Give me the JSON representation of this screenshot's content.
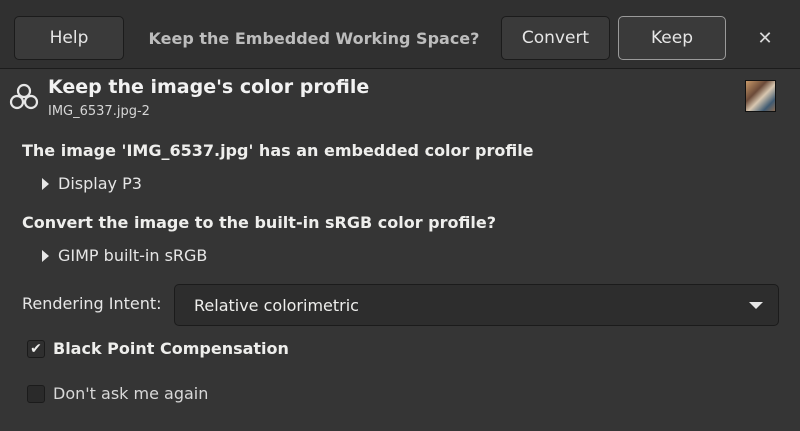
{
  "headerbar": {
    "help_label": "Help",
    "title": "Keep the Embedded Working Space?",
    "convert_label": "Convert",
    "keep_label": "Keep",
    "close_glyph": "✕"
  },
  "header": {
    "icon": "gimp-logo-icon",
    "title": "Keep the image's color profile",
    "subtitle": "IMG_6537.jpg-2",
    "thumbnail_icon": "image-thumbnail"
  },
  "embedded": {
    "question": "The image 'IMG_6537.jpg' has an embedded color profile",
    "profile": "Display P3"
  },
  "convert": {
    "question": "Convert the image to the built-in sRGB color profile?",
    "profile": "GIMP built-in sRGB"
  },
  "rendering_intent": {
    "label": "Rendering Intent:",
    "value": "Relative colorimetric"
  },
  "black_point": {
    "label": "Black Point Compensation",
    "checked": true,
    "mark": "✔"
  },
  "dont_ask": {
    "label": "Don't ask me again",
    "checked": false
  },
  "colors": {
    "background": "#353535",
    "headerbar": "#303030",
    "text": "#eeeeec"
  }
}
